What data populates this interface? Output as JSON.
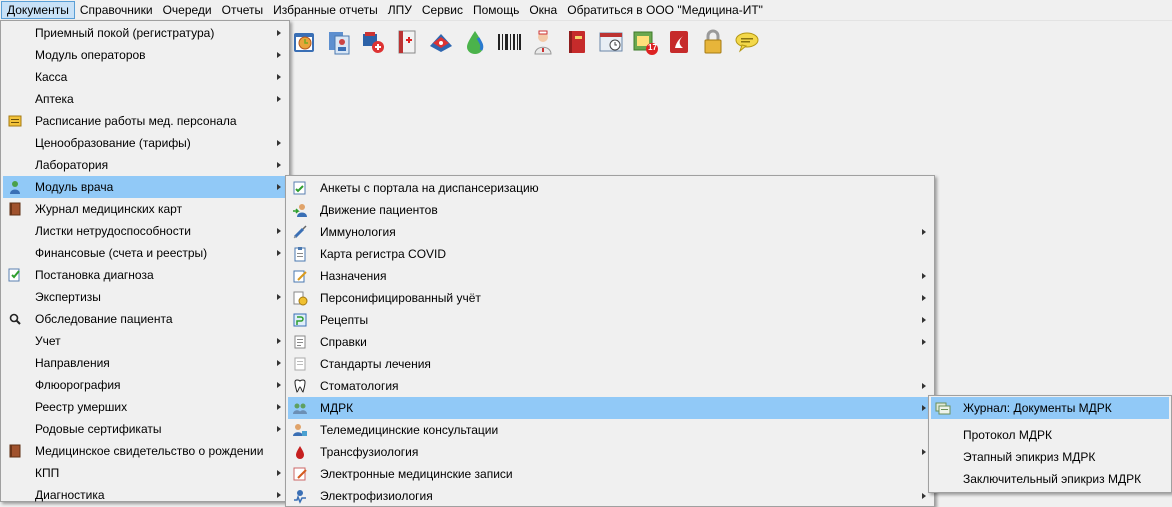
{
  "menubar": {
    "items": [
      "Документы",
      "Справочники",
      "Очереди",
      "Отчеты",
      "Избранные отчеты",
      "ЛПУ",
      "Сервис",
      "Помощь",
      "Окна",
      "Обратиться в ООО \"Медицина-ИТ\""
    ]
  },
  "toolbar": {
    "icons": [
      "calendar-clock-icon",
      "patients-icon",
      "syringe-icon",
      "medical-book-icon",
      "ambulance-icon",
      "drop-icon",
      "barcode-icon",
      "nurse-icon",
      "red-book-icon",
      "schedule-icon",
      "calendar-17-icon",
      "pdf-icon",
      "lock-icon",
      "chat-icon"
    ],
    "calendar_day": "17"
  },
  "menu1": {
    "items": [
      {
        "label": "Приемный покой (регистратура)",
        "submenu": true,
        "icon": ""
      },
      {
        "label": "Модуль операторов",
        "submenu": true,
        "icon": ""
      },
      {
        "label": "Касса",
        "submenu": true,
        "icon": ""
      },
      {
        "label": "Аптека",
        "submenu": true,
        "icon": ""
      },
      {
        "label": "Расписание работы мед. персонала",
        "submenu": false,
        "icon": "schedule-icon"
      },
      {
        "label": "Ценообразование (тарифы)",
        "submenu": true,
        "icon": ""
      },
      {
        "label": "Лаборатория",
        "submenu": true,
        "icon": ""
      },
      {
        "label": "Модуль врача",
        "submenu": true,
        "icon": "doctor-icon"
      },
      {
        "label": "Журнал медицинских карт",
        "submenu": false,
        "icon": "book-icon"
      },
      {
        "label": "Листки нетрудоспособности",
        "submenu": true,
        "icon": ""
      },
      {
        "label": "Финансовые (счета и реестры)",
        "submenu": true,
        "icon": ""
      },
      {
        "label": "Постановка диагноза",
        "submenu": false,
        "icon": "diagnosis-icon"
      },
      {
        "label": "Экспертизы",
        "submenu": true,
        "icon": ""
      },
      {
        "label": "Обследование пациента",
        "submenu": false,
        "icon": "search-icon"
      },
      {
        "label": "Учет",
        "submenu": true,
        "icon": ""
      },
      {
        "label": "Направления",
        "submenu": true,
        "icon": ""
      },
      {
        "label": "Флюорография",
        "submenu": true,
        "icon": ""
      },
      {
        "label": "Реестр умерших",
        "submenu": true,
        "icon": ""
      },
      {
        "label": "Родовые сертификаты",
        "submenu": true,
        "icon": ""
      },
      {
        "label": "Медицинское свидетельство о рождении",
        "submenu": false,
        "icon": "book-icon"
      },
      {
        "label": "КПП",
        "submenu": true,
        "icon": ""
      },
      {
        "label": "Диагностика",
        "submenu": true,
        "icon": ""
      }
    ]
  },
  "menu2": {
    "items": [
      {
        "label": "Анкеты с портала на диспансеризацию",
        "submenu": false,
        "icon": "form-check-icon"
      },
      {
        "label": "Движение пациентов",
        "submenu": false,
        "icon": "patients-move-icon"
      },
      {
        "label": "Иммунология",
        "submenu": true,
        "icon": "syringe-icon"
      },
      {
        "label": "Карта регистра COVID",
        "submenu": false,
        "icon": "clipboard-icon"
      },
      {
        "label": "Назначения",
        "submenu": true,
        "icon": "prescription-icon"
      },
      {
        "label": "Персонифицированный учёт",
        "submenu": true,
        "icon": "coins-icon"
      },
      {
        "label": "Рецепты",
        "submenu": true,
        "icon": "recipe-icon"
      },
      {
        "label": "Справки",
        "submenu": true,
        "icon": "document-icon"
      },
      {
        "label": "Стандарты лечения",
        "submenu": false,
        "icon": "standards-icon"
      },
      {
        "label": "Стоматология",
        "submenu": true,
        "icon": "tooth-icon"
      },
      {
        "label": "МДРК",
        "submenu": true,
        "icon": "mdrk-icon"
      },
      {
        "label": "Телемедицинские консультации",
        "submenu": false,
        "icon": "telemed-icon"
      },
      {
        "label": "Трансфузиология",
        "submenu": true,
        "icon": "blood-drop-icon"
      },
      {
        "label": "Электронные медицинские записи",
        "submenu": false,
        "icon": "emr-icon"
      },
      {
        "label": "Электрофизиология",
        "submenu": true,
        "icon": "ecg-icon"
      }
    ]
  },
  "menu3": {
    "items": [
      {
        "label": "Журнал: Документы МДРК",
        "icon": "journal-icon"
      },
      {
        "label": "Протокол МДРК",
        "icon": ""
      },
      {
        "label": "Этапный эпикриз МДРК",
        "icon": ""
      },
      {
        "label": "Заключительный эпикриз МДРК",
        "icon": ""
      }
    ]
  }
}
